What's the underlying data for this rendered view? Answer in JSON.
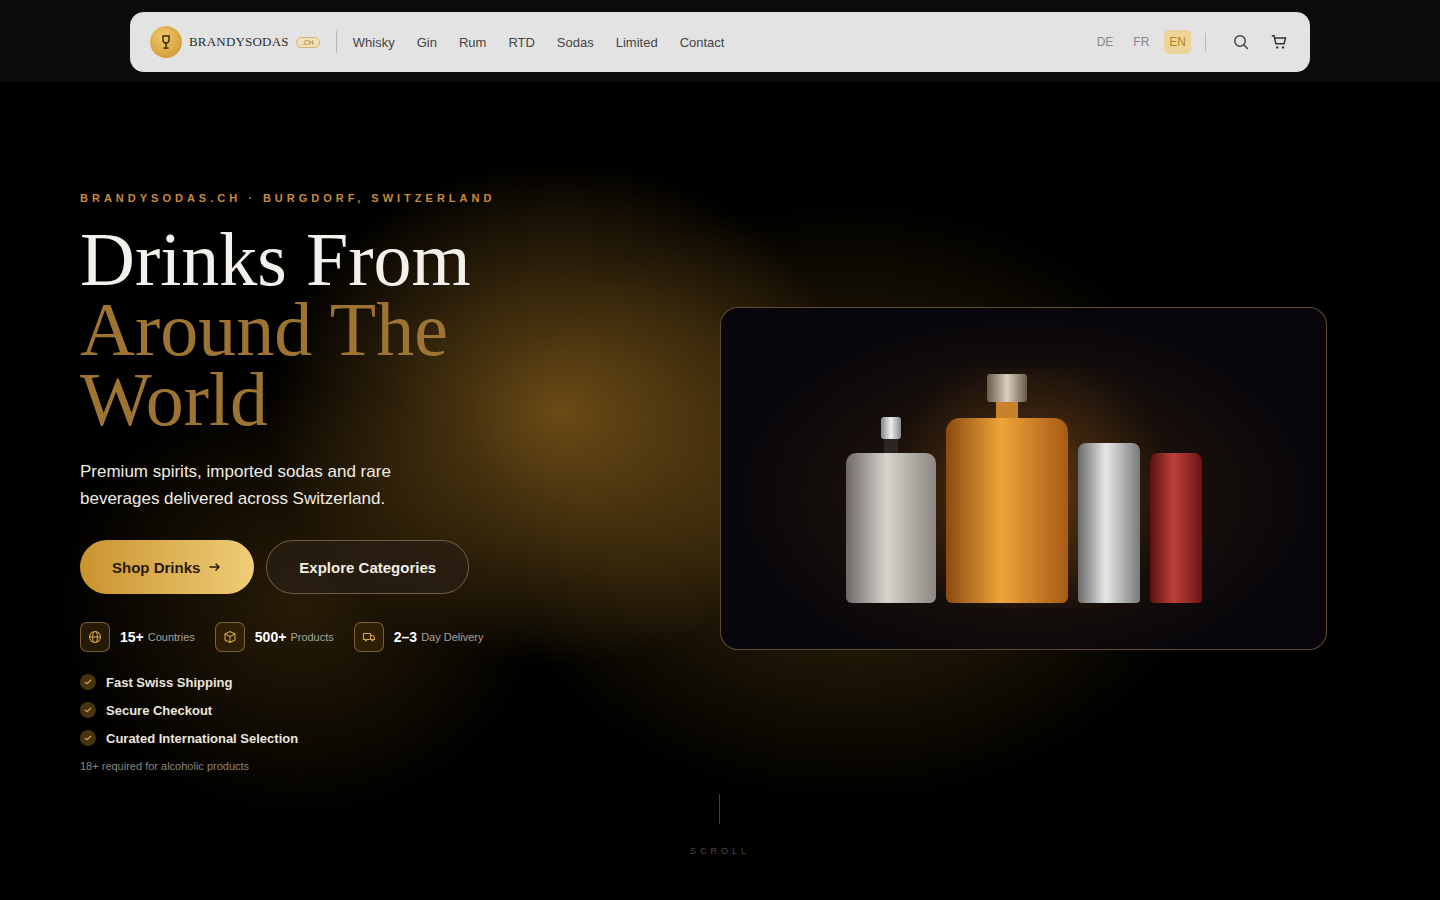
{
  "nav": {
    "brand": "BRANDYSODAS",
    "badge": ".CH",
    "links": [
      "Whisky",
      "Gin",
      "Rum",
      "RTD",
      "Sodas",
      "Limited",
      "Contact"
    ],
    "languages": [
      {
        "label": "DE",
        "selected": false
      },
      {
        "label": "FR",
        "selected": false
      },
      {
        "label": "EN",
        "selected": true
      }
    ]
  },
  "hero": {
    "eyebrow": "BRANDYSODAS.CH · BURGDORF, SWITZERLAND",
    "title": [
      {
        "text": "Drinks From",
        "accent": false
      },
      {
        "text": "Around The",
        "accent": true
      },
      {
        "text": "World",
        "accent": true
      }
    ],
    "subtitle": "Premium spirits, imported sodas and rare beverages delivered across Switzerland.",
    "buttons": [
      {
        "label": "Shop Drinks",
        "kind": "primary"
      },
      {
        "label": "Explore Categories",
        "kind": "secondary"
      }
    ],
    "stats": [
      {
        "value": "15+",
        "label": "Countries",
        "kind": "globe"
      },
      {
        "value": "500+",
        "label": "Products",
        "kind": "box"
      },
      {
        "value": "2–3",
        "label": "Day Delivery",
        "kind": "truck"
      }
    ],
    "features": [
      "Fast Swiss Shipping",
      "Secure Checkout",
      "Curated International Selection"
    ],
    "note": "18+ required for alcoholic products"
  },
  "scroll": "SCROLL"
}
